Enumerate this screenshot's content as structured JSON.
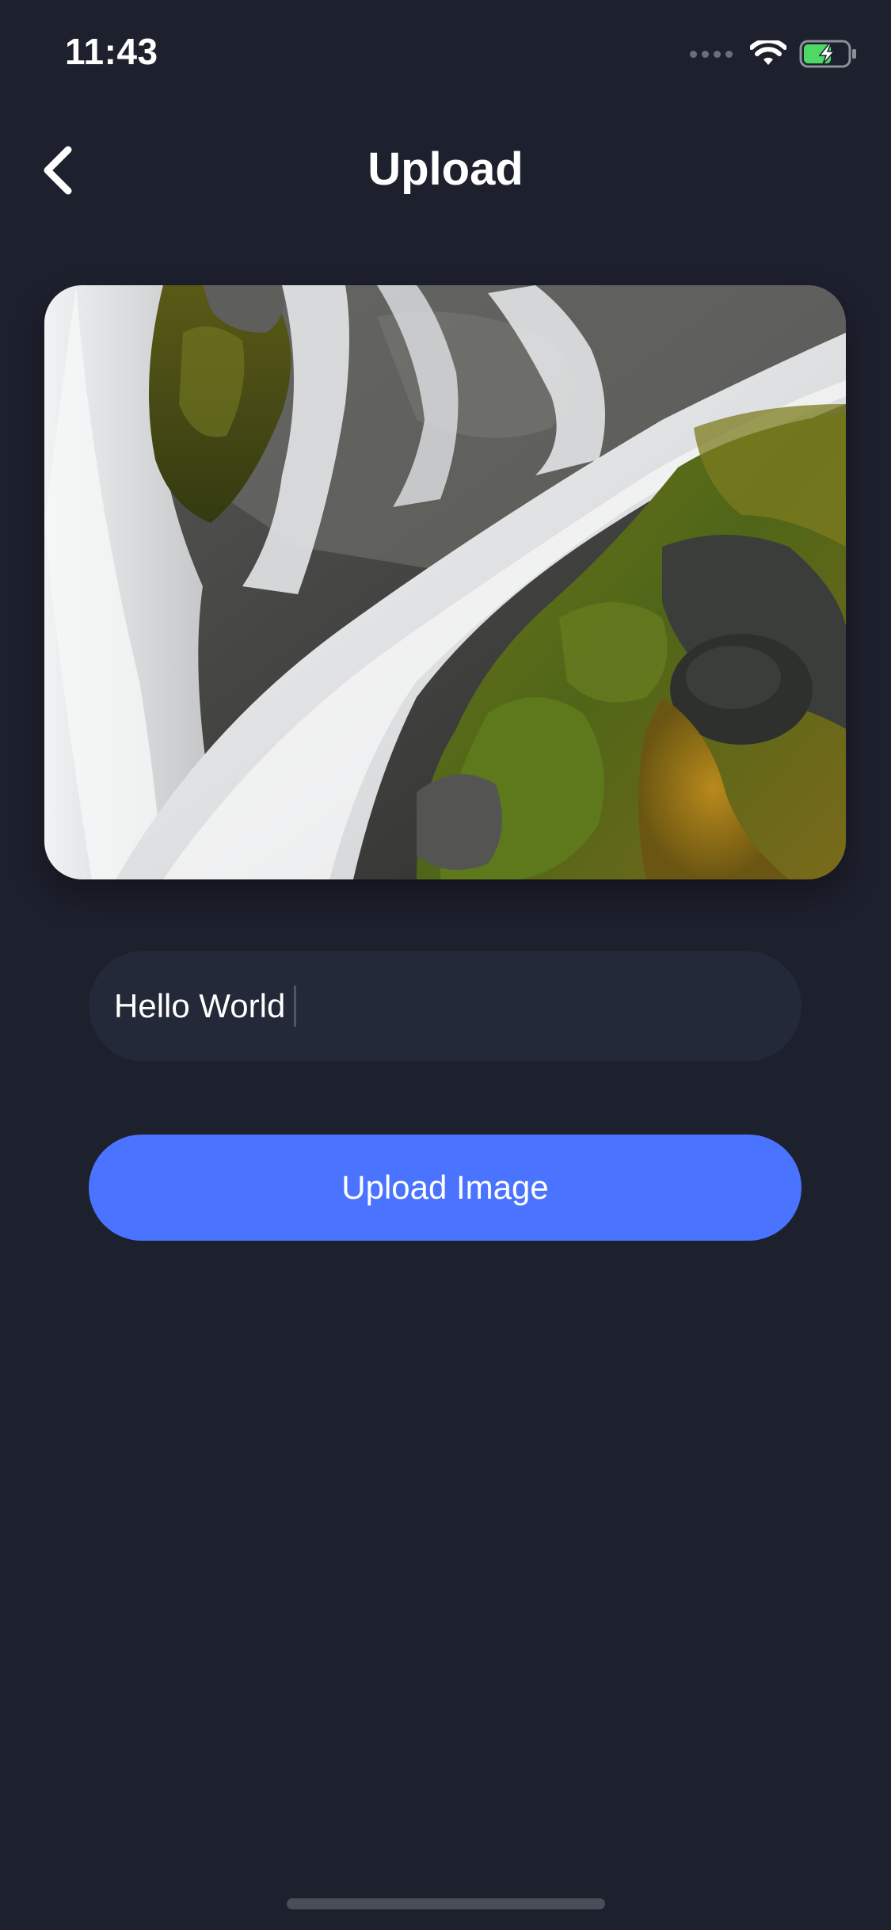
{
  "status_bar": {
    "time": "11:43",
    "wifi_icon": "wifi-icon",
    "battery_icon": "battery-charging-icon",
    "battery_color": "#4cd964"
  },
  "nav": {
    "title": "Upload",
    "back_icon": "chevron-left-icon"
  },
  "preview": {
    "icon": "waterfall-photo"
  },
  "caption_input": {
    "value": "Hello World"
  },
  "upload_button": {
    "label": "Upload Image"
  },
  "colors": {
    "background": "#1d202d",
    "input_background": "#232938",
    "accent": "#4a73ff"
  }
}
